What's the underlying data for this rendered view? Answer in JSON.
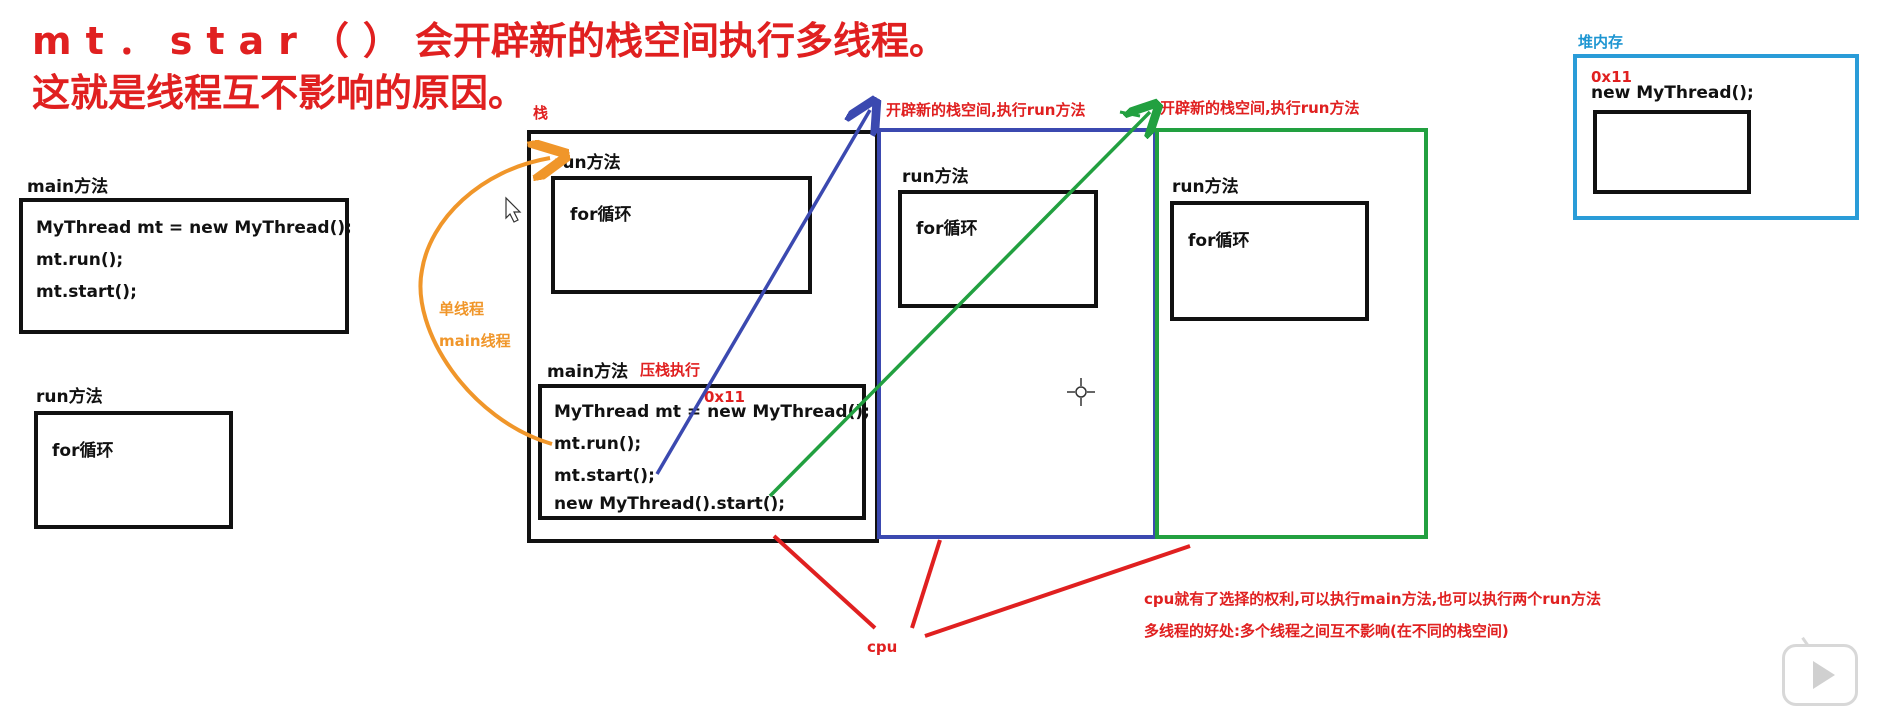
{
  "title": {
    "line1_code": "mt．star（）",
    "line1_rest": "会开辟新的栈空间执行多线程。",
    "line2": "这就是线程互不影响的原因。"
  },
  "left_panel": {
    "main_label": "main方法",
    "main_code": [
      "MyThread mt = new MyThread();",
      "mt.run();",
      "mt.start();"
    ],
    "run_label": "run方法",
    "for_loop": "for循环"
  },
  "stack": {
    "label": "栈",
    "run_label": "run方法",
    "for_loop": "for循环",
    "main_label": "main方法",
    "push_label": "压栈执行",
    "address": "0x11",
    "code": [
      "MyThread mt = new MyThread();",
      "mt.run();",
      "mt.start();",
      "new MyThread().start();"
    ]
  },
  "single_thread": {
    "line1": "单线程",
    "line2": "main线程"
  },
  "thread_stack_1": {
    "caption": "开辟新的栈空间,执行run方法",
    "run_label": "run方法",
    "for_loop": "for循环"
  },
  "thread_stack_2": {
    "caption": "开辟新的栈空间,执行run方法",
    "run_label": "run方法",
    "for_loop": "for循环"
  },
  "heap": {
    "label": "堆内存",
    "address": "0x11",
    "object": "new MyThread();"
  },
  "cpu": {
    "label": "cpu",
    "note1": "cpu就有了选择的权利,可以执行main方法,也可以执行两个run方法",
    "note2": "多线程的好处:多个线程之间互不影响(在不同的栈空间)"
  },
  "colors": {
    "red": "#e02020",
    "orange": "#f0962a",
    "blue_arrow": "#3b49b0",
    "green_arrow": "#22a040",
    "heap_blue": "#2a9cd8"
  }
}
